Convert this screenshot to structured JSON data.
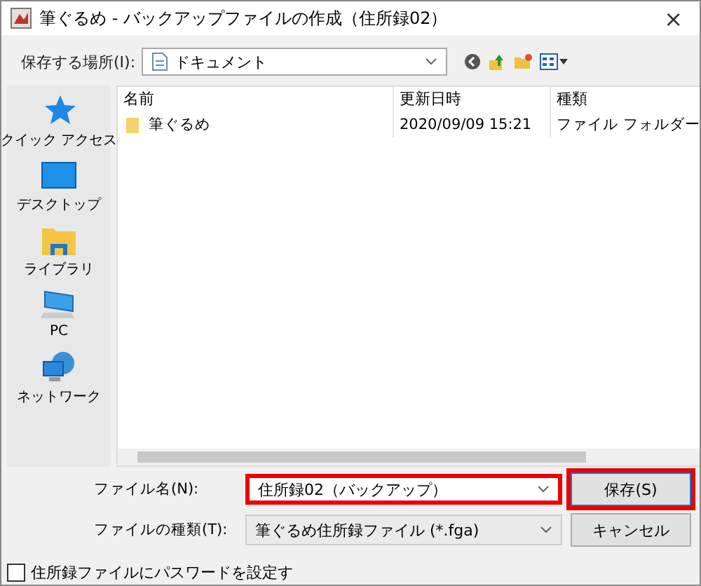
{
  "window": {
    "title": "筆ぐるめ - バックアップファイルの作成（住所録02）",
    "close": "×"
  },
  "location": {
    "label": "保存する場所(I):",
    "value": "ドキュメント"
  },
  "sidebar": {
    "items": [
      {
        "kind": "star",
        "label": "クイック アクセス"
      },
      {
        "kind": "desktop",
        "label": "デスクトップ"
      },
      {
        "kind": "library",
        "label": "ライブラリ"
      },
      {
        "kind": "pc",
        "label": "PC"
      },
      {
        "kind": "network",
        "label": "ネットワーク"
      }
    ]
  },
  "table": {
    "columns": [
      "名前",
      "更新日時",
      "種類"
    ],
    "rows": [
      {
        "name": "筆ぐるめ",
        "modified": "2020/09/09 15:21",
        "type": "ファイル フォルダー"
      }
    ]
  },
  "filename": {
    "label": "ファイル名(N):",
    "value": "住所録02（バックアップ）",
    "highlighted": true
  },
  "filetype": {
    "label": "ファイルの種類(T):",
    "value": "筆ぐるめ住所録ファイル (*.fga)"
  },
  "buttons": [
    {
      "label": "保存(S)",
      "highlighted": true
    },
    {
      "label": "キャンセル",
      "highlighted": false
    }
  ],
  "password": {
    "label": "住所録ファイルにパスワードを設定す",
    "checked": false
  }
}
